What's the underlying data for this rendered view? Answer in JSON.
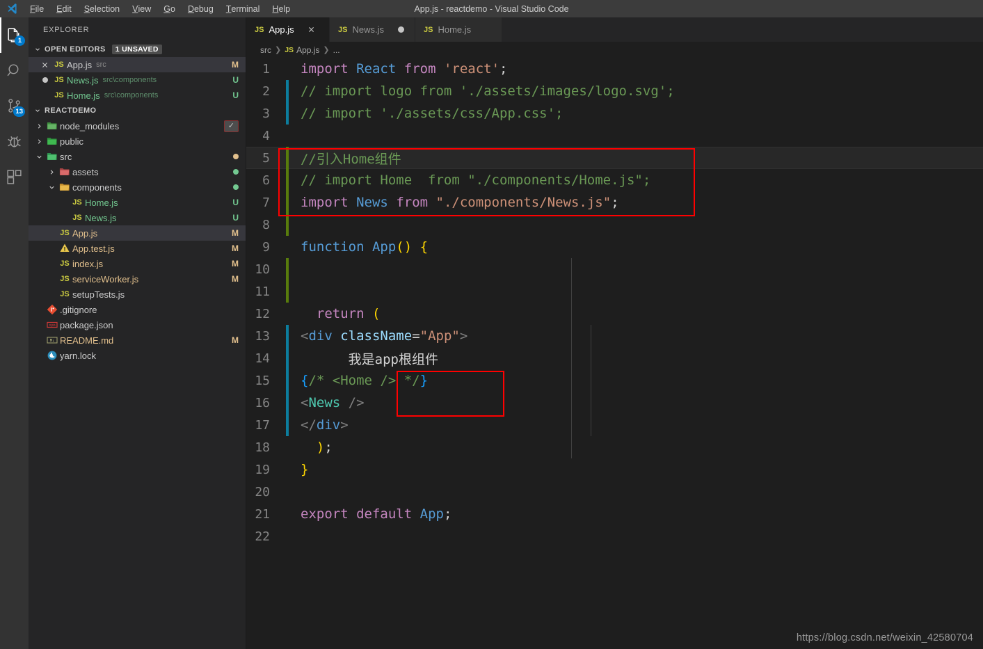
{
  "titlebar": {
    "window_title": "App.js - reactdemo - Visual Studio Code",
    "logo_icon": "vscode-logo-icon",
    "menus": [
      {
        "label": "File",
        "mnemonic": "F"
      },
      {
        "label": "Edit",
        "mnemonic": "E"
      },
      {
        "label": "Selection",
        "mnemonic": "S"
      },
      {
        "label": "View",
        "mnemonic": "V"
      },
      {
        "label": "Go",
        "mnemonic": "G"
      },
      {
        "label": "Debug",
        "mnemonic": "D"
      },
      {
        "label": "Terminal",
        "mnemonic": "T"
      },
      {
        "label": "Help",
        "mnemonic": "H"
      }
    ]
  },
  "activitybar": {
    "items": [
      {
        "name": "explorer",
        "icon": "files-icon",
        "badge": "1",
        "active": true
      },
      {
        "name": "search",
        "icon": "search-icon",
        "badge": "",
        "active": false
      },
      {
        "name": "source-control",
        "icon": "source-control-icon",
        "badge": "13",
        "active": false
      },
      {
        "name": "debug",
        "icon": "debug-icon",
        "badge": "",
        "active": false
      },
      {
        "name": "extensions",
        "icon": "extensions-icon",
        "badge": "",
        "active": false
      }
    ]
  },
  "sidebar": {
    "title": "EXPLORER",
    "open_editors": {
      "label": "OPEN EDITORS",
      "badge": "1 UNSAVED",
      "items": [
        {
          "name": "App.js",
          "desc": "src",
          "status": "M",
          "status_class": "st-M",
          "icon": "js-file-icon",
          "lead": "close",
          "selected": true
        },
        {
          "name": "News.js",
          "desc": "src\\components",
          "status": "U",
          "status_class": "st-U",
          "icon": "js-file-icon",
          "lead": "dirty",
          "selected": false
        },
        {
          "name": "Home.js",
          "desc": "src\\components",
          "status": "U",
          "status_class": "st-U",
          "icon": "js-file-icon",
          "lead": "none",
          "selected": false
        }
      ]
    },
    "project": {
      "label": "REACTDEMO",
      "items": [
        {
          "name": "node_modules",
          "kind": "folder",
          "icon": "folder-node-icon",
          "expanded": false,
          "indent": 1,
          "badge": "✓",
          "badge_kind": "error-box"
        },
        {
          "name": "public",
          "kind": "folder",
          "icon": "folder-public-icon",
          "expanded": false,
          "indent": 1,
          "badge": "",
          "badge_kind": ""
        },
        {
          "name": "src",
          "kind": "folder",
          "icon": "folder-src-icon",
          "expanded": true,
          "indent": 1,
          "badge": "",
          "badge_kind": "dot-M",
          "dot_color": "#e2c08d"
        },
        {
          "name": "assets",
          "kind": "folder",
          "icon": "folder-assets-icon",
          "expanded": false,
          "indent": 2,
          "badge": "",
          "badge_kind": "dot-U",
          "dot_color": "#73c991"
        },
        {
          "name": "components",
          "kind": "folder",
          "icon": "folder-components-icon",
          "expanded": true,
          "indent": 2,
          "badge": "",
          "badge_kind": "dot-U",
          "dot_color": "#73c991"
        },
        {
          "name": "Home.js",
          "kind": "js",
          "icon": "js-file-icon",
          "indent": 3,
          "status": "U",
          "status_class": "st-U"
        },
        {
          "name": "News.js",
          "kind": "js",
          "icon": "js-file-icon",
          "indent": 3,
          "status": "U",
          "status_class": "st-U"
        },
        {
          "name": "App.js",
          "kind": "js",
          "icon": "js-file-icon",
          "indent": 2,
          "status": "M",
          "status_class": "st-M",
          "selected": true
        },
        {
          "name": "App.test.js",
          "kind": "test",
          "icon": "js-test-file-icon",
          "indent": 2,
          "status": "M",
          "status_class": "st-M"
        },
        {
          "name": "index.js",
          "kind": "js",
          "icon": "js-file-icon",
          "indent": 2,
          "status": "M",
          "status_class": "st-M"
        },
        {
          "name": "serviceWorker.js",
          "kind": "js",
          "icon": "js-file-icon",
          "indent": 2,
          "status": "M",
          "status_class": "st-M"
        },
        {
          "name": "setupTests.js",
          "kind": "js",
          "icon": "js-file-icon",
          "indent": 2,
          "status": "",
          "status_class": ""
        },
        {
          "name": ".gitignore",
          "kind": "git",
          "icon": "git-file-icon",
          "indent": 1,
          "status": "",
          "status_class": ""
        },
        {
          "name": "package.json",
          "kind": "npm",
          "icon": "npm-file-icon",
          "indent": 1,
          "status": "",
          "status_class": ""
        },
        {
          "name": "README.md",
          "kind": "md",
          "icon": "markdown-file-icon",
          "indent": 1,
          "status": "M",
          "status_class": "st-M"
        },
        {
          "name": "yarn.lock",
          "kind": "yarn",
          "icon": "yarn-file-icon",
          "indent": 1,
          "status": "",
          "status_class": ""
        }
      ]
    }
  },
  "editor": {
    "tabs": [
      {
        "label": "App.js",
        "icon": "js-file-icon",
        "active": true,
        "dirty": false,
        "closable": true
      },
      {
        "label": "News.js",
        "icon": "js-file-icon",
        "active": false,
        "dirty": true,
        "closable": false
      },
      {
        "label": "Home.js",
        "icon": "js-file-icon",
        "active": false,
        "dirty": false,
        "closable": false
      }
    ],
    "breadcrumb": [
      "src",
      "App.js",
      "..."
    ],
    "line_numbers": [
      1,
      2,
      3,
      4,
      5,
      6,
      7,
      8,
      9,
      10,
      11,
      12,
      13,
      14,
      15,
      16,
      17,
      18,
      19,
      20,
      21,
      22
    ],
    "code_lines": [
      "import React from 'react';",
      "// import logo from './assets/images/logo.svg';",
      "// import './assets/css/App.css';",
      "",
      "//引入Home组件",
      "// import Home  from \"./components/Home.js\";",
      "import News from \"./components/News.js\";",
      "",
      "function App() {",
      "",
      "",
      "  return (",
      "    <div className=\"App\">",
      "      我是app根组件",
      "      {/* <Home /> */}",
      "      <News />",
      "    </div>",
      "  );",
      "}",
      "",
      "export default App;",
      ""
    ],
    "gutter_marks": [
      {
        "line": 2,
        "kind": "modified"
      },
      {
        "line": 3,
        "kind": "modified"
      },
      {
        "line": 5,
        "kind": "added"
      },
      {
        "line": 6,
        "kind": "added"
      },
      {
        "line": 7,
        "kind": "added"
      },
      {
        "line": 8,
        "kind": "added"
      },
      {
        "line": 10,
        "kind": "added"
      },
      {
        "line": 11,
        "kind": "added"
      },
      {
        "line": 13,
        "kind": "modified"
      },
      {
        "line": 14,
        "kind": "modified"
      },
      {
        "line": 15,
        "kind": "modified"
      },
      {
        "line": 16,
        "kind": "modified"
      },
      {
        "line": 17,
        "kind": "modified"
      }
    ],
    "current_line": 5,
    "annotations": [
      {
        "name": "import-highlight-box",
        "lines": "5-7",
        "color": "#ff0000"
      },
      {
        "name": "jsx-highlight-box",
        "lines": "15-16",
        "color": "#ff0000"
      }
    ]
  },
  "watermark": "https://blog.csdn.net/weixin_42580704",
  "colors": {
    "accent": "#007acc",
    "annotation": "#ff0000",
    "editor_bg": "#1e1e1e",
    "sidebar_bg": "#252526",
    "activitybar_bg": "#333333",
    "titlebar_bg": "#3c3c3c",
    "modified_gutter": "#0c7d9d",
    "added_gutter": "#587c0c",
    "status_modified": "#e2c08d",
    "status_untracked": "#73c991"
  }
}
